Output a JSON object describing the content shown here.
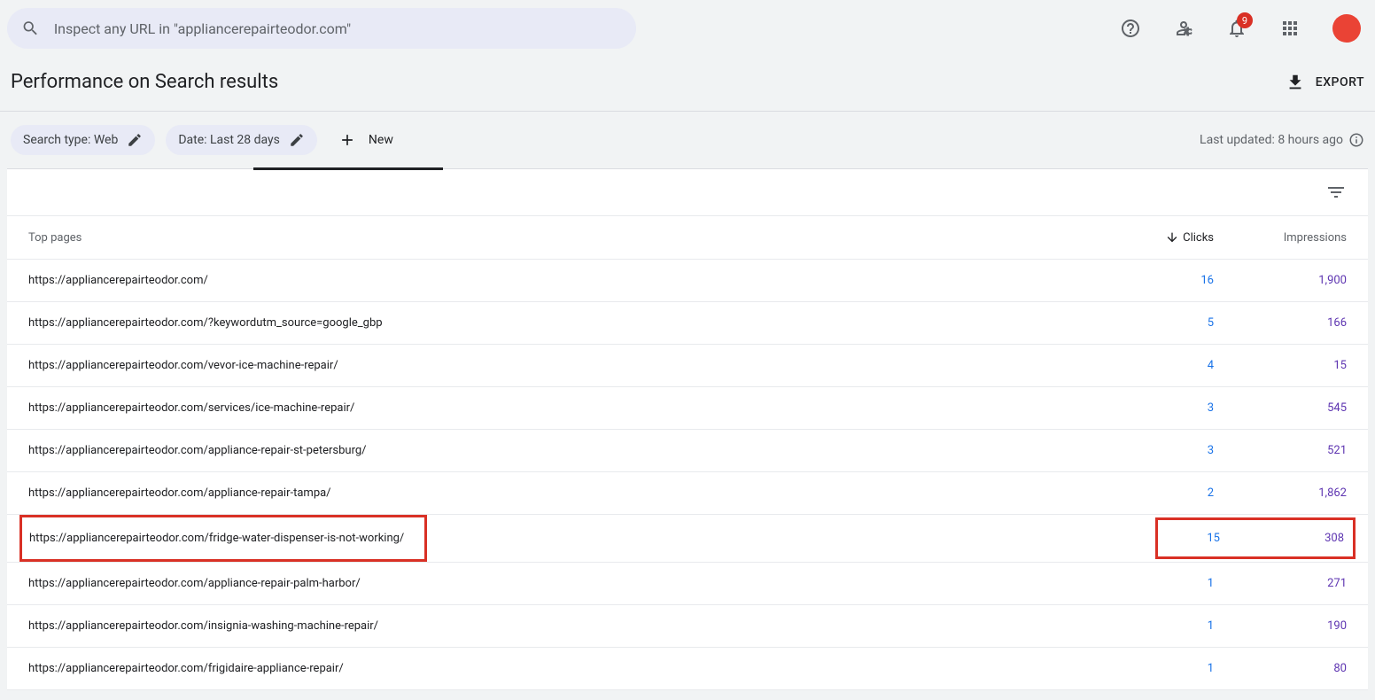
{
  "search": {
    "placeholder": "Inspect any URL in \"appliancerepairteodor.com\""
  },
  "notifications": {
    "count": "9"
  },
  "page": {
    "title": "Performance on Search results",
    "export_label": "EXPORT"
  },
  "filters": {
    "search_type": "Search type: Web",
    "date": "Date: Last 28 days",
    "new_label": "New",
    "last_updated": "Last updated: 8 hours ago"
  },
  "table": {
    "headers": {
      "pages": "Top pages",
      "clicks": "Clicks",
      "impressions": "Impressions"
    },
    "rows": [
      {
        "url": "https://appliancerepairteodor.com/",
        "clicks": "16",
        "impressions": "1,900",
        "highlighted": false
      },
      {
        "url": "https://appliancerepairteodor.com/?keywordutm_source=google_gbp",
        "clicks": "5",
        "impressions": "166",
        "highlighted": false
      },
      {
        "url": "https://appliancerepairteodor.com/vevor-ice-machine-repair/",
        "clicks": "4",
        "impressions": "15",
        "highlighted": false
      },
      {
        "url": "https://appliancerepairteodor.com/services/ice-machine-repair/",
        "clicks": "3",
        "impressions": "545",
        "highlighted": false
      },
      {
        "url": "https://appliancerepairteodor.com/appliance-repair-st-petersburg/",
        "clicks": "3",
        "impressions": "521",
        "highlighted": false
      },
      {
        "url": "https://appliancerepairteodor.com/appliance-repair-tampa/",
        "clicks": "2",
        "impressions": "1,862",
        "highlighted": false
      },
      {
        "url": "https://appliancerepairteodor.com/fridge-water-dispenser-is-not-working/",
        "clicks": "15",
        "impressions": "308",
        "highlighted": true
      },
      {
        "url": "https://appliancerepairteodor.com/appliance-repair-palm-harbor/",
        "clicks": "1",
        "impressions": "271",
        "highlighted": false
      },
      {
        "url": "https://appliancerepairteodor.com/insignia-washing-machine-repair/",
        "clicks": "1",
        "impressions": "190",
        "highlighted": false
      },
      {
        "url": "https://appliancerepairteodor.com/frigidaire-appliance-repair/",
        "clicks": "1",
        "impressions": "80",
        "highlighted": false
      }
    ]
  }
}
